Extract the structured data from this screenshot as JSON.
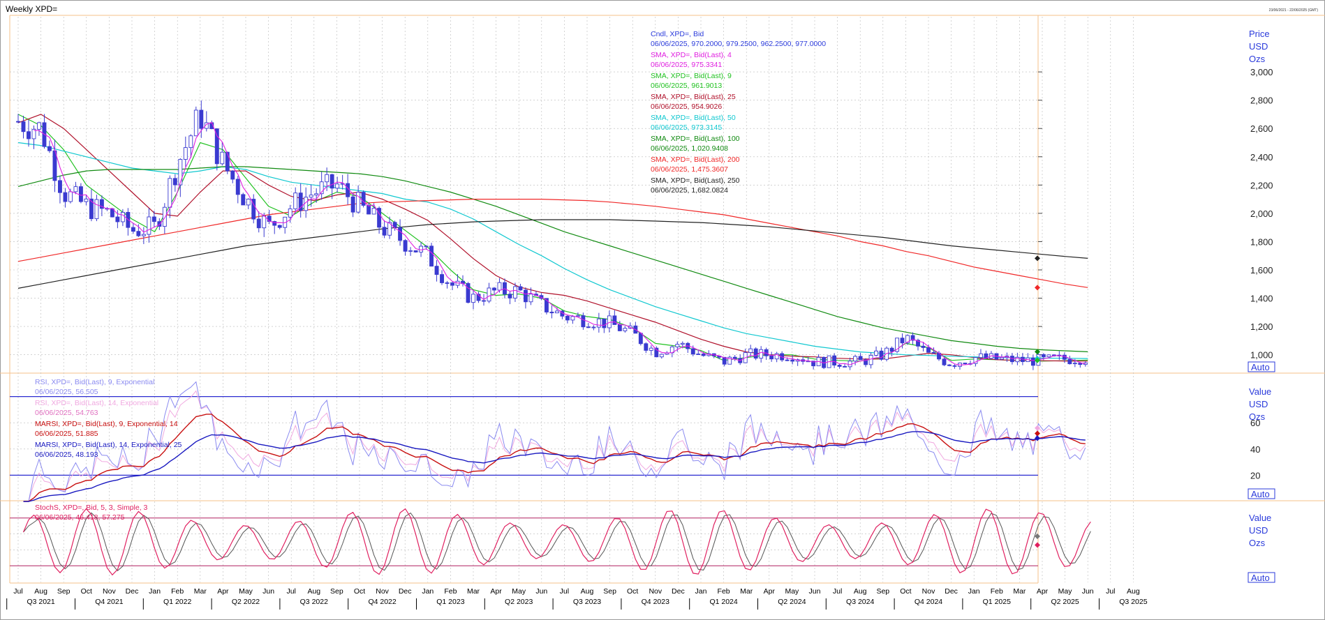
{
  "window": {
    "title": "Weekly XPD=",
    "stamp": "23/06/2021 - 22/06/2025 (GMT)"
  },
  "colors": {
    "candle": "#3a3ad0",
    "sma4": "#e020e0",
    "sma9": "#22c222",
    "sma25": "#b0102a",
    "sma50": "#10c8d0",
    "sma100": "#108a10",
    "sma200": "#f02828",
    "sma250": "#222222",
    "rsi9": "#8a8af0",
    "rsi14": "#f0a8e0",
    "marsi9": "#c81010",
    "marsi14": "#1818c0",
    "stochK": "#e02060",
    "stochD": "#555555",
    "grid": "#b8b8b8",
    "axis": "#2a3adb"
  },
  "price_pane": {
    "axis_title": [
      "Price",
      "USD",
      "Ozs"
    ],
    "ticks": [
      "3,000",
      "2,800",
      "2,600",
      "2,400",
      "2,200",
      "2,000",
      "1,800",
      "1,600",
      "1,400",
      "1,200",
      "1,000"
    ],
    "auto": "Auto",
    "legend": [
      {
        "label": "Cndl, XPD=, Bid",
        "value": "06/06/2025, 970.2000, 979.2500, 962.2500, 977.0000",
        "color": "#2a3adb"
      },
      {
        "label": "SMA, XPD=, Bid(Last),  4",
        "value": "06/06/2025, 975.3341",
        "color": "#e020e0"
      },
      {
        "label": "SMA, XPD=, Bid(Last),  9",
        "value": "06/06/2025, 961.9013",
        "color": "#22c222"
      },
      {
        "label": "SMA, XPD=, Bid(Last),  25",
        "value": "06/06/2025, 954.9026",
        "color": "#b0102a"
      },
      {
        "label": "SMA, XPD=, Bid(Last),  50",
        "value": "06/06/2025, 973.3145",
        "color": "#10c8d0"
      },
      {
        "label": "SMA, XPD=, Bid(Last),  100",
        "value": "06/06/2025, 1,020.9408",
        "color": "#108a10"
      },
      {
        "label": "SMA, XPD=, Bid(Last),  200",
        "value": "06/06/2025, 1,475.3607",
        "color": "#f02828"
      },
      {
        "label": "SMA, XPD=, Bid(Last),  250",
        "value": "06/06/2025, 1,682.0824",
        "color": "#222222"
      }
    ]
  },
  "rsi_pane": {
    "axis_title": [
      "Value",
      "USD",
      "Ozs"
    ],
    "ticks": [
      "60",
      "40",
      "20"
    ],
    "auto": "Auto",
    "legend": [
      {
        "label": "RSI, XPD=, Bid(Last),  9, Exponential",
        "value": "06/06/2025, 56.505",
        "color": "#8a8af0"
      },
      {
        "label": "RSI, XPD=, Bid(Last),  14, Exponential",
        "value": "06/06/2025, 54.763",
        "color": "#f0a8e0"
      },
      {
        "label": "MARSI, XPD=, Bid(Last),  9, Exponential, 14",
        "value": "06/06/2025, 51.885",
        "color": "#c81010"
      },
      {
        "label": "MARSI, XPD=, Bid(Last),  14, Exponential, 25",
        "value": "06/06/2025, 48.193",
        "color": "#1818c0"
      }
    ]
  },
  "stoch_pane": {
    "axis_title": [
      "Value",
      "USD",
      "Ozs"
    ],
    "auto": "Auto",
    "legend": [
      {
        "label": "StochS, XPD=, Bid,  5, 3, Simple, 3",
        "value": "06/06/2025, 46.418, 57.275",
        "color": "#e02060"
      }
    ]
  },
  "x_axis": {
    "months": [
      "Jul",
      "Aug",
      "Sep",
      "Oct",
      "Nov",
      "Dec",
      "Jan",
      "Feb",
      "Mar",
      "Apr",
      "May",
      "Jun",
      "Jul",
      "Aug",
      "Sep",
      "Oct",
      "Nov",
      "Dec",
      "Jan",
      "Feb",
      "Mar",
      "Apr",
      "May",
      "Jun",
      "Jul",
      "Aug",
      "Sep",
      "Oct",
      "Nov",
      "Dec",
      "Jan",
      "Feb",
      "Mar",
      "Apr",
      "May",
      "Jun",
      "Jul",
      "Aug",
      "Sep",
      "Oct",
      "Nov",
      "Dec",
      "Jan",
      "Feb",
      "Mar",
      "Apr",
      "May",
      "Jun",
      "Jul",
      "Aug"
    ],
    "quarters": [
      "Q3 2021",
      "Q4 2021",
      "Q1 2022",
      "Q2 2022",
      "Q3 2022",
      "Q4 2022",
      "Q1 2023",
      "Q2 2023",
      "Q3 2023",
      "Q4 2023",
      "Q1 2024",
      "Q2 2024",
      "Q3 2024",
      "Q4 2024",
      "Q1 2025",
      "Q2 2025",
      "Q3 2025"
    ]
  },
  "chart_data": {
    "type": "line",
    "title": "Weekly XPD=",
    "ylabel": "Price USD Ozs",
    "ylim": [
      880,
      3400
    ],
    "months_x": [
      "2021-07",
      "2021-08",
      "2021-09",
      "2021-10",
      "2021-11",
      "2021-12",
      "2022-01",
      "2022-02",
      "2022-03",
      "2022-04",
      "2022-05",
      "2022-06",
      "2022-07",
      "2022-08",
      "2022-09",
      "2022-10",
      "2022-11",
      "2022-12",
      "2023-01",
      "2023-02",
      "2023-03",
      "2023-04",
      "2023-05",
      "2023-06",
      "2023-07",
      "2023-08",
      "2023-09",
      "2023-10",
      "2023-11",
      "2023-12",
      "2024-01",
      "2024-02",
      "2024-03",
      "2024-04",
      "2024-05",
      "2024-06",
      "2024-07",
      "2024-08",
      "2024-09",
      "2024-10",
      "2024-11",
      "2024-12",
      "2025-01",
      "2025-02",
      "2025-03",
      "2025-04",
      "2025-05",
      "2025-06"
    ],
    "close_monthly": [
      2650,
      2600,
      2150,
      2050,
      2000,
      1880,
      1900,
      2350,
      2700,
      2350,
      2100,
      1900,
      2050,
      2150,
      2200,
      2050,
      1900,
      1800,
      1700,
      1500,
      1400,
      1450,
      1450,
      1350,
      1270,
      1250,
      1220,
      1150,
      1020,
      1080,
      1000,
      950,
      1000,
      1000,
      1000,
      950,
      950,
      950,
      1000,
      1120,
      1000,
      940,
      980,
      970,
      960,
      960,
      970,
      977
    ],
    "series": [
      {
        "name": "SMA, XPD=, Bid(Last), 9",
        "values": [
          2700,
          2620,
          2450,
          2200,
          2080,
          1960,
          1870,
          2150,
          2500,
          2450,
          2250,
          2050,
          1980,
          2080,
          2150,
          2120,
          2000,
          1880,
          1760,
          1600,
          1460,
          1420,
          1430,
          1400,
          1310,
          1270,
          1250,
          1190,
          1080,
          1060,
          1030,
          960,
          980,
          1000,
          1000,
          970,
          960,
          955,
          980,
          1080,
          1050,
          960,
          970,
          965,
          960,
          955,
          958,
          961.9
        ]
      },
      {
        "name": "SMA, XPD=, Bid(Last), 25",
        "values": [
          2640,
          2700,
          2600,
          2450,
          2300,
          2150,
          2000,
          1980,
          2150,
          2300,
          2300,
          2200,
          2120,
          2090,
          2130,
          2150,
          2100,
          2030,
          1950,
          1820,
          1680,
          1560,
          1480,
          1440,
          1420,
          1380,
          1330,
          1280,
          1230,
          1170,
          1110,
          1060,
          1020,
          1000,
          990,
          985,
          975,
          970,
          970,
          990,
          1010,
          1000,
          980,
          965,
          960,
          958,
          956,
          954.9
        ]
      },
      {
        "name": "SMA, XPD=, Bid(Last), 50",
        "values": [
          2500,
          2480,
          2440,
          2400,
          2360,
          2320,
          2300,
          2280,
          2300,
          2330,
          2310,
          2260,
          2220,
          2200,
          2180,
          2160,
          2140,
          2100,
          2080,
          2030,
          1960,
          1870,
          1780,
          1700,
          1610,
          1530,
          1460,
          1400,
          1340,
          1290,
          1240,
          1190,
          1150,
          1120,
          1090,
          1060,
          1040,
          1020,
          1010,
          1000,
          995,
          990,
          985,
          980,
          978,
          976,
          975,
          973.3
        ]
      },
      {
        "name": "SMA, XPD=, Bid(Last), 100",
        "values": [
          2190,
          2230,
          2270,
          2300,
          2310,
          2310,
          2310,
          2310,
          2320,
          2330,
          2330,
          2320,
          2310,
          2300,
          2290,
          2280,
          2260,
          2230,
          2190,
          2150,
          2100,
          2050,
          1990,
          1930,
          1870,
          1820,
          1770,
          1720,
          1670,
          1620,
          1570,
          1520,
          1470,
          1420,
          1370,
          1320,
          1270,
          1230,
          1190,
          1160,
          1130,
          1100,
          1080,
          1060,
          1045,
          1035,
          1028,
          1020.9
        ]
      },
      {
        "name": "SMA, XPD=, Bid(Last), 200",
        "values": [
          1660,
          1690,
          1720,
          1750,
          1780,
          1810,
          1840,
          1870,
          1900,
          1930,
          1960,
          1990,
          2010,
          2030,
          2050,
          2070,
          2080,
          2085,
          2090,
          2095,
          2100,
          2100,
          2100,
          2100,
          2095,
          2090,
          2080,
          2065,
          2050,
          2030,
          2010,
          1990,
          1960,
          1930,
          1900,
          1870,
          1840,
          1800,
          1770,
          1730,
          1700,
          1660,
          1620,
          1590,
          1560,
          1530,
          1500,
          1475.4
        ]
      },
      {
        "name": "SMA, XPD=, Bid(Last), 250",
        "values": [
          1470,
          1500,
          1530,
          1560,
          1590,
          1620,
          1650,
          1680,
          1710,
          1740,
          1770,
          1790,
          1810,
          1830,
          1850,
          1870,
          1890,
          1905,
          1920,
          1930,
          1940,
          1945,
          1950,
          1955,
          1955,
          1955,
          1955,
          1950,
          1945,
          1940,
          1935,
          1925,
          1915,
          1905,
          1890,
          1875,
          1860,
          1845,
          1830,
          1810,
          1790,
          1770,
          1755,
          1740,
          1725,
          1710,
          1695,
          1682.1
        ]
      }
    ]
  }
}
